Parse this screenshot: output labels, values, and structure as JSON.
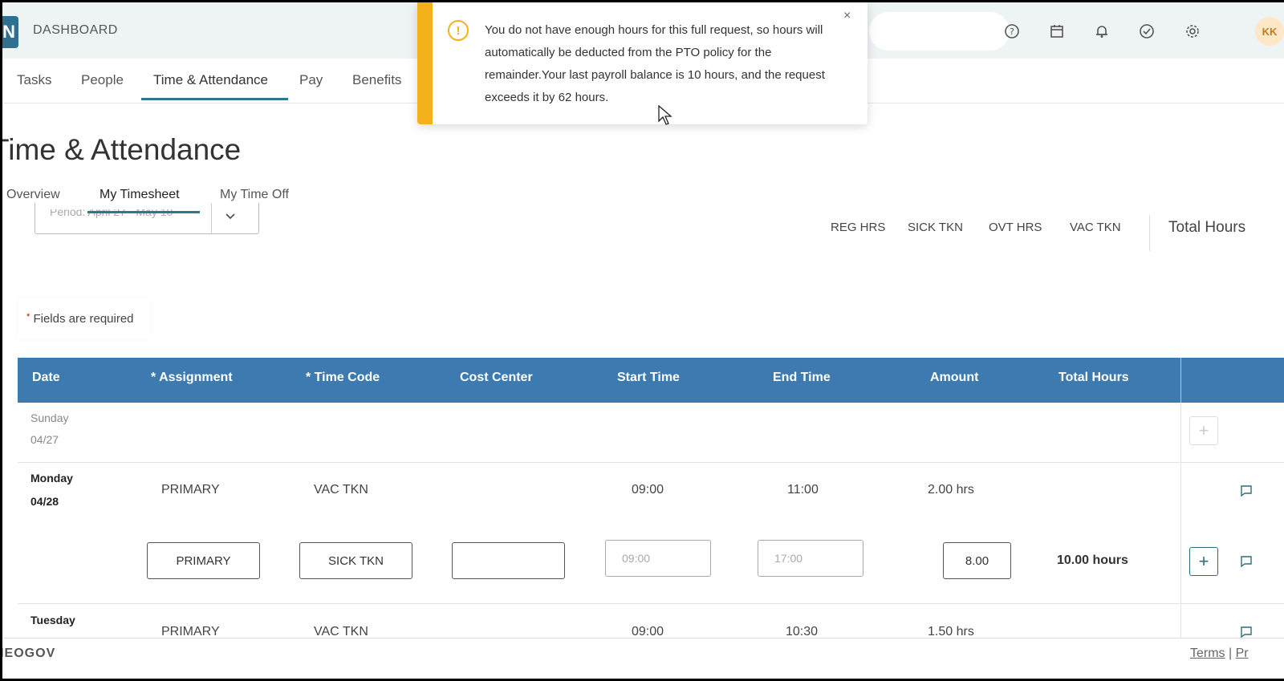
{
  "header": {
    "logo_letter": "N",
    "brand": "DASHBOARD",
    "avatar_initials": "KK",
    "icons": [
      "help-icon",
      "calendar-icon",
      "bell-icon",
      "check-circle-icon",
      "settings-icon"
    ]
  },
  "nav": {
    "items": [
      "Tasks",
      "People",
      "Time & Attendance",
      "Pay",
      "Benefits"
    ],
    "active": "Time & Attendance"
  },
  "page": {
    "title": "Time & Attendance",
    "tabs": [
      "Overview",
      "My Timesheet",
      "My Time Off"
    ],
    "active_tab": "My Timesheet",
    "period_label": "Period: April 27 - May 10"
  },
  "summary": {
    "columns": [
      "REG HRS",
      "SICK TKN",
      "OVT HRS",
      "VAC TKN"
    ],
    "total_label": "Total Hours"
  },
  "required_note": "Fields are required",
  "table": {
    "headers": {
      "date": "Date",
      "assignment": "Assignment",
      "time_code": "Time Code",
      "cost_center": "Cost Center",
      "start_time": "Start Time",
      "end_time": "End Time",
      "amount": "Amount",
      "total_hours": "Total Hours"
    },
    "rows": [
      {
        "day": "Sunday",
        "date": "04/27"
      },
      {
        "day": "Monday",
        "date": "04/28",
        "assignment": "PRIMARY",
        "time_code": "VAC TKN",
        "start": "09:00",
        "end": "11:00",
        "amount": "2.00 hrs"
      },
      {
        "assignment_input": "PRIMARY",
        "time_code_input": "SICK TKN",
        "cost_center_input": "",
        "start_placeholder": "09:00",
        "end_placeholder": "17:00",
        "amount_input": "8.00",
        "total": "10.00 hours"
      },
      {
        "day": "Tuesday",
        "assignment": "PRIMARY",
        "time_code": "VAC TKN",
        "start": "09:00",
        "end": "10:30",
        "amount": "1.50 hrs"
      }
    ]
  },
  "footer": {
    "brand": "NEOGOV",
    "terms": "Terms",
    "privacy": "Pr"
  },
  "toast": {
    "message": "You do not have enough hours for this full request, so hours will automatically be deducted from the PTO policy for the remainder.Your last payroll balance is 10 hours, and the request exceeds it by 62 hours.",
    "close": "×",
    "accent": "#f3b21b"
  },
  "colors": {
    "table_header": "#3c7ab0",
    "accent": "#2b7a8a"
  }
}
